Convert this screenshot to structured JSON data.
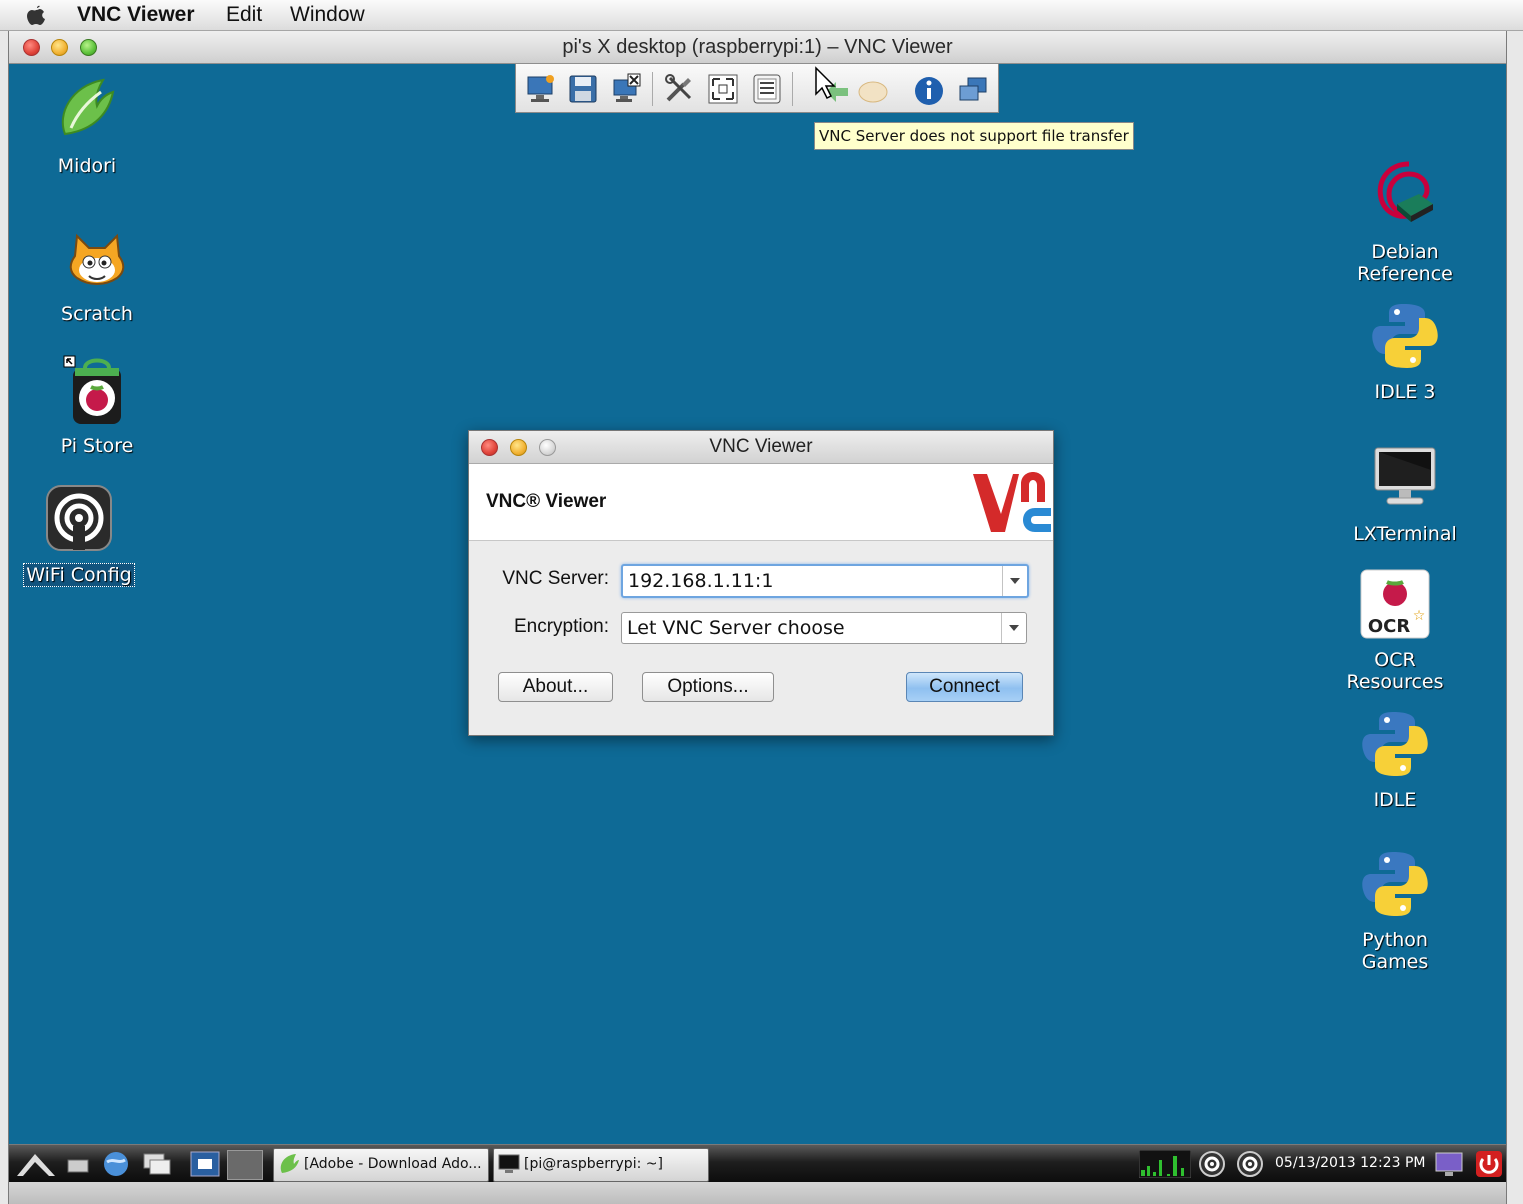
{
  "menubar": {
    "app": "VNC Viewer",
    "items": [
      "Edit",
      "Window"
    ]
  },
  "window": {
    "title": "pi's X desktop (raspberrypi:1) – VNC Viewer"
  },
  "tooltip": "VNC Server does not support file transfer",
  "desktop_icons_left": [
    {
      "label": "Midori",
      "icon": "midori-icon"
    },
    {
      "label": "Scratch",
      "icon": "scratch-icon"
    },
    {
      "label": "Pi Store",
      "icon": "pi-store-icon"
    },
    {
      "label": "WiFi Config",
      "icon": "wifi-config-icon"
    }
  ],
  "desktop_icons_right": [
    {
      "label_line1": "Debian",
      "label_line2": "Reference",
      "icon": "debian-reference-icon"
    },
    {
      "label": "IDLE 3",
      "icon": "python-icon"
    },
    {
      "label": "LXTerminal",
      "icon": "terminal-icon"
    },
    {
      "label": "OCR Resources",
      "icon": "ocr-icon"
    },
    {
      "label": "IDLE",
      "icon": "python-icon"
    },
    {
      "label": "Python Games",
      "icon": "python-icon"
    }
  ],
  "dialog": {
    "title": "VNC Viewer",
    "brand": "VNC® Viewer",
    "server_label": "VNC Server:",
    "server_value": "192.168.1.11:1",
    "encryption_label": "Encryption:",
    "encryption_value": "Let VNC Server choose",
    "about_button": "About...",
    "options_button": "Options...",
    "connect_button": "Connect"
  },
  "taskbar": {
    "tasks": [
      "[Adobe - Download Ado...",
      "[pi@raspberrypi: ~]"
    ],
    "clock": "05/13/2013 12:23 PM"
  },
  "colors": {
    "desktop": "#0e6a96",
    "tooltip_bg": "#ffffcc",
    "vnc_red": "#d42a2a",
    "vnc_blue": "#2a8ad4"
  }
}
